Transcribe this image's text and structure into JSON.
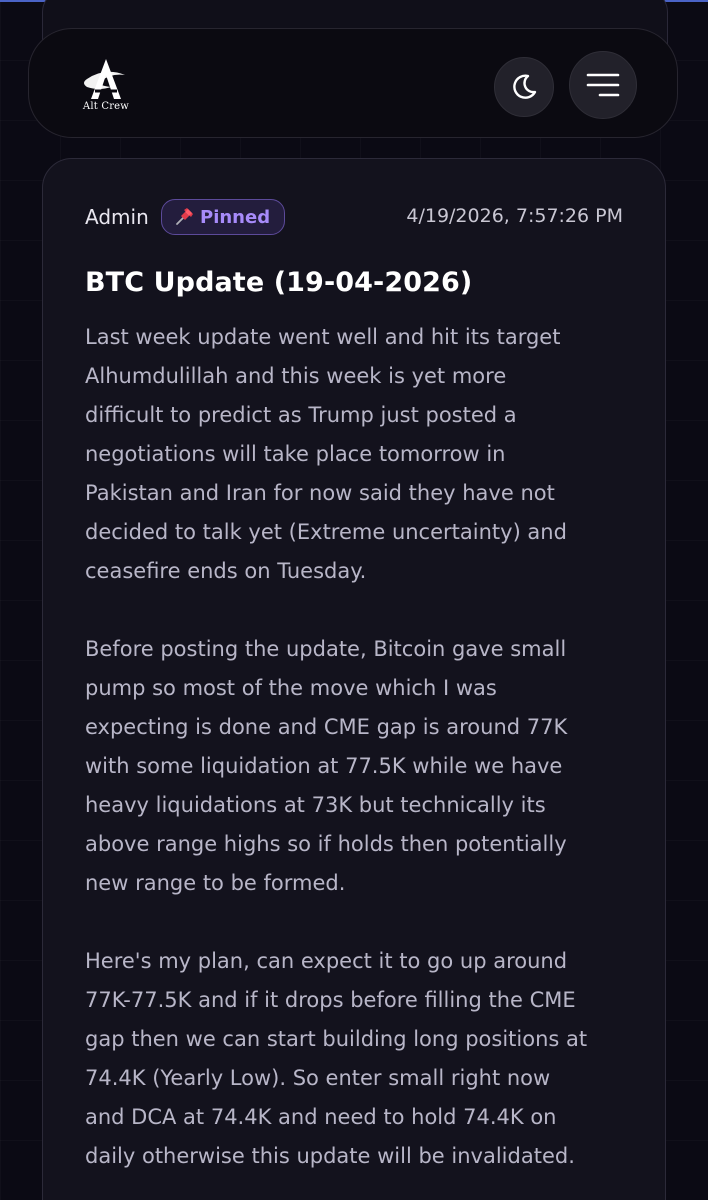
{
  "header": {
    "logo_text": "Alt Crew",
    "theme_icon": "moon-icon",
    "menu_icon": "hamburger-menu-icon"
  },
  "post": {
    "author": "Admin",
    "pinned_label": "Pinned",
    "pin_icon": "pushpin-icon",
    "timestamp": "4/19/2026, 7:57:26 PM",
    "title": "BTC Update (19-04-2026)",
    "paragraphs": [
      "Last week update went well and hit its target\nAlhumdulillah and this week is yet more\ndifficult to predict as Trump just posted a\nnegotiations will take place tomorrow in\nPakistan and Iran for now said they have not\ndecided to talk yet (Extreme uncertainty) and\nceasefire ends on Tuesday.",
      "Before posting the update, Bitcoin gave small\npump so most of the move which I was\nexpecting is done and CME gap is around 77K\nwith some liquidation at 77.5K while we have\nheavy liquidations at 73K but technically its\nabove range highs so if holds then potentially\nnew range to be formed.",
      "Here's my plan, can expect it to go up around\n77K-77.5K and if it drops before filling the CME\ngap then we can start building long positions at\n74.4K (Yearly Low). So enter small right now\nand DCA at 74.4K and need to hold 74.4K on\ndaily otherwise this update will be invalidated."
    ]
  },
  "colors": {
    "background": "#0b0a14",
    "card": "#13121d",
    "accent_purple": "#a78bfa",
    "body_text": "#b8b6c8"
  }
}
